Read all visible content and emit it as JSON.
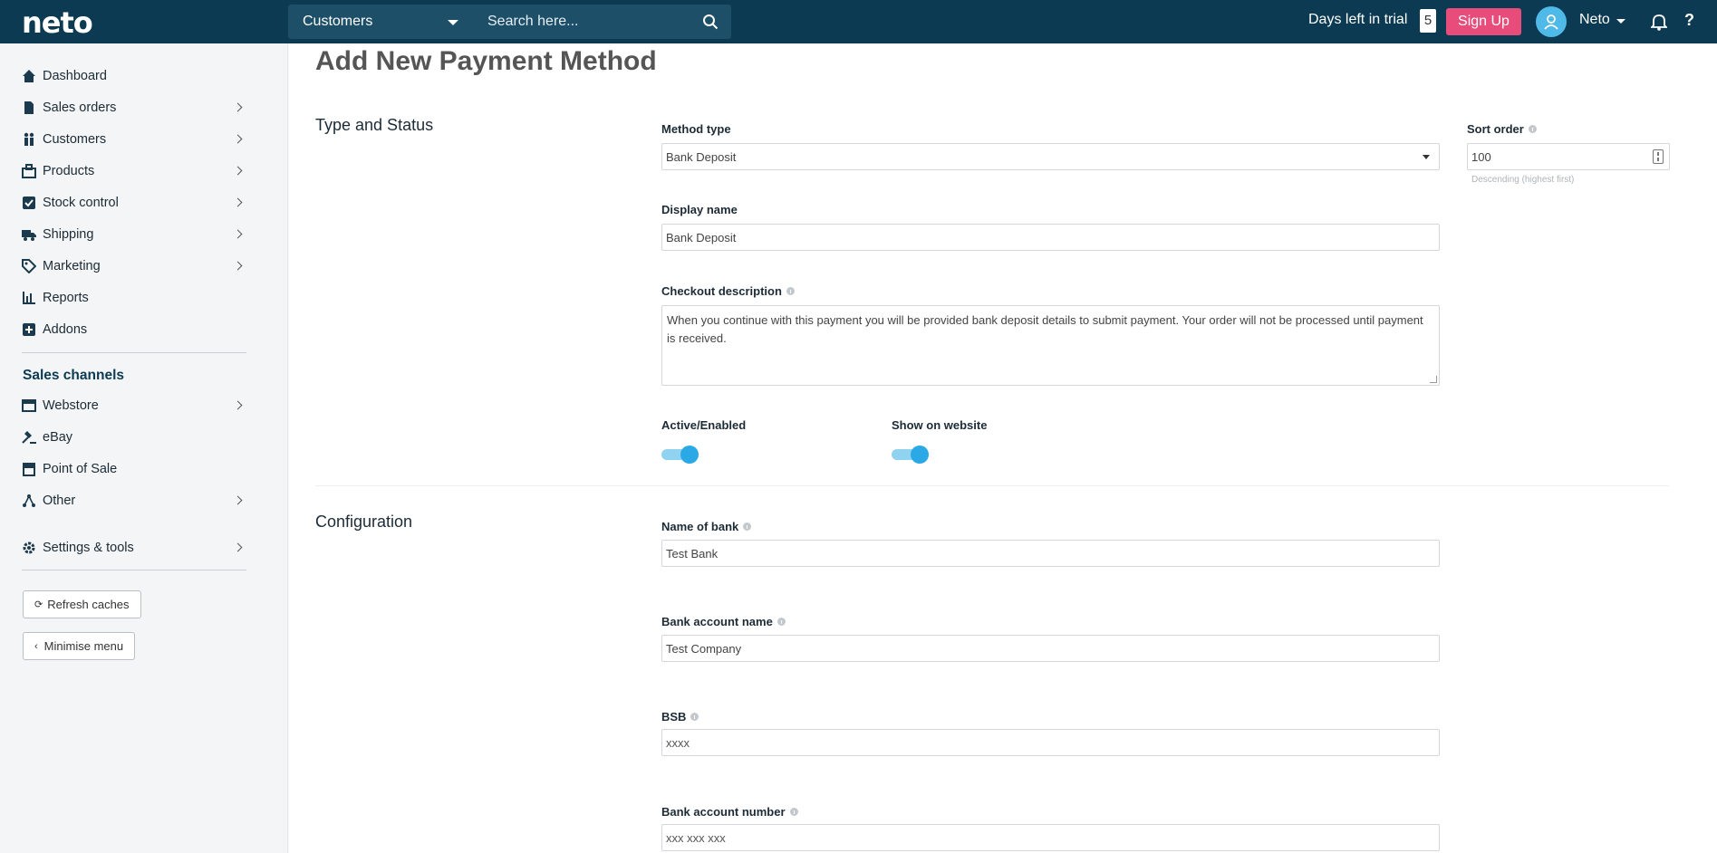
{
  "brand": {
    "logo": "neto"
  },
  "search": {
    "scope": "Customers",
    "placeholder": "Search here..."
  },
  "header": {
    "trial_label": "Days left in trial",
    "trial_days": "5",
    "signup_label": "Sign Up",
    "user_name": "Neto",
    "help_label": "?"
  },
  "sidebar": {
    "items": [
      {
        "label": "Dashboard",
        "icon": "home-icon"
      },
      {
        "label": "Sales orders",
        "icon": "document-icon"
      },
      {
        "label": "Customers",
        "icon": "people-icon"
      },
      {
        "label": "Products",
        "icon": "box-icon"
      },
      {
        "label": "Stock control",
        "icon": "checkbox-icon"
      },
      {
        "label": "Shipping",
        "icon": "truck-icon"
      },
      {
        "label": "Marketing",
        "icon": "tag-icon"
      },
      {
        "label": "Reports",
        "icon": "bar-chart-icon"
      },
      {
        "label": "Addons",
        "icon": "plus-square-icon"
      }
    ],
    "channels_heading": "Sales channels",
    "channels": [
      {
        "label": "Webstore",
        "icon": "browser-icon"
      },
      {
        "label": "eBay",
        "icon": "gavel-icon"
      },
      {
        "label": "Point of Sale",
        "icon": "store-icon"
      },
      {
        "label": "Other",
        "icon": "network-icon"
      }
    ],
    "settings_label": "Settings & tools",
    "refresh_label": "Refresh caches",
    "minimise_label": "Minimise menu"
  },
  "page": {
    "title": "Add New Payment Method"
  },
  "type_status": {
    "heading": "Type and Status",
    "method_type_label": "Method type",
    "method_type_value": "Bank Deposit",
    "sort_order_label": "Sort order",
    "sort_order_value": "100",
    "sort_order_hint": "Descending (highest first)",
    "display_name_label": "Display name",
    "display_name_value": "Bank Deposit",
    "checkout_desc_label": "Checkout description",
    "checkout_desc_value": "When you continue with this payment you will be provided bank deposit details to submit payment. Your order will not be processed until payment is received.",
    "active_label": "Active/Enabled",
    "active_on": true,
    "show_label": "Show on website",
    "show_on": true
  },
  "configuration": {
    "heading": "Configuration",
    "bank_name_label": "Name of bank",
    "bank_name_value": "Test Bank",
    "account_name_label": "Bank account name",
    "account_name_value": "Test Company",
    "bsb_label": "BSB",
    "bsb_placeholder": "xxxx",
    "account_number_label": "Bank account number",
    "account_number_placeholder": "xxx xxx xxx"
  },
  "colors": {
    "topbar": "#0c3a52",
    "accent": "#2ba9e6",
    "signup": "#e84c7a"
  }
}
